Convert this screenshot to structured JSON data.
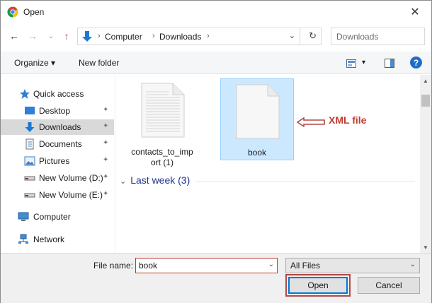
{
  "window": {
    "title": "Open",
    "close_glyph": "✕"
  },
  "nav": {
    "back_glyph": "←",
    "forward_glyph": "→",
    "recent_glyph": "⌄",
    "up_glyph": "↑"
  },
  "address": {
    "crumbs": [
      "Computer",
      "Downloads"
    ],
    "separator": "›",
    "dropdown_glyph": "⌄",
    "refresh_glyph": "↻"
  },
  "search": {
    "placeholder": "Downloads"
  },
  "toolbar": {
    "organize_label": "Organize ▾",
    "new_folder_label": "New folder",
    "view_dropdown_glyph": "▾",
    "help_glyph": "?"
  },
  "sidebar": {
    "items": [
      {
        "label": "Quick access",
        "icon": "star-icon"
      },
      {
        "label": "Desktop",
        "icon": "desktop-icon",
        "pinned": true
      },
      {
        "label": "Downloads",
        "icon": "download-arrow-icon",
        "pinned": true,
        "selected": true
      },
      {
        "label": "Documents",
        "icon": "document-icon",
        "pinned": true
      },
      {
        "label": "Pictures",
        "icon": "picture-icon",
        "pinned": true
      },
      {
        "label": "New Volume (D:)",
        "icon": "drive-icon",
        "pinned": true
      },
      {
        "label": "New Volume (E:)",
        "icon": "drive-icon",
        "pinned": true
      },
      {
        "label": "Computer",
        "icon": "computer-icon"
      },
      {
        "label": "Network",
        "icon": "network-icon"
      }
    ],
    "pin_glyph": "📌"
  },
  "files": [
    {
      "name_line1": "contacts_to_imp",
      "name_line2": "ort (1)",
      "selected": false,
      "icon": "text-file-icon"
    },
    {
      "name_line1": "book",
      "name_line2": "",
      "selected": true,
      "icon": "blank-file-icon"
    }
  ],
  "group": {
    "label": "Last week (3)",
    "chevron": "⌄"
  },
  "annotation": {
    "text": "XML file",
    "color": "#c0392b"
  },
  "scroll": {
    "up_glyph": "▲",
    "down_glyph": "▼"
  },
  "bottom": {
    "file_name_label": "File name:",
    "file_name_value": "book",
    "file_type_value": "All Files",
    "drop_glyph": "⌄",
    "open_label": "Open",
    "cancel_label": "Cancel"
  },
  "colors": {
    "accent": "#0078d7",
    "selection": "#cce8ff",
    "highlight_box": "#b04848"
  }
}
